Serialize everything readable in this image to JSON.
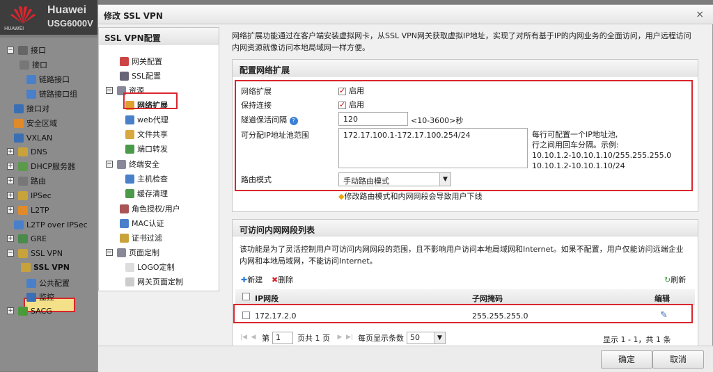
{
  "app": {
    "brand": "Huawei",
    "model": "USG6000V",
    "logo_text": "HUAWEI"
  },
  "nav": {
    "items": [
      {
        "label": "接口",
        "toggle": "−",
        "icon": "monitor-icon"
      },
      {
        "label": "接口",
        "icon": "interface-icon"
      },
      {
        "label": "链路接口",
        "icon": "link-icon"
      },
      {
        "label": "链路接口组",
        "icon": "link-group-icon"
      },
      {
        "label": "接口对",
        "icon": "interface-pair-icon"
      },
      {
        "label": "安全区域",
        "icon": "zone-icon"
      },
      {
        "label": "VXLAN",
        "icon": "vxlan-icon"
      },
      {
        "label": "DNS",
        "toggle": "+",
        "icon": "dns-icon"
      },
      {
        "label": "DHCP服务器",
        "toggle": "+",
        "icon": "dhcp-icon"
      },
      {
        "label": "路由",
        "toggle": "+",
        "icon": "route-icon"
      },
      {
        "label": "IPSec",
        "toggle": "+",
        "icon": "ipsec-icon"
      },
      {
        "label": "L2TP",
        "toggle": "+",
        "icon": "l2tp-icon"
      },
      {
        "label": "L2TP over IPSec",
        "icon": "l2tp-ipsec-icon"
      },
      {
        "label": "GRE",
        "toggle": "+",
        "icon": "gre-icon"
      },
      {
        "label": "SSL VPN",
        "toggle": "−",
        "icon": "sslvpn-icon"
      },
      {
        "label": "SSL VPN",
        "icon": "sslvpn-sub-icon"
      },
      {
        "label": "公共配置",
        "icon": "common-config-icon"
      },
      {
        "label": "监控",
        "icon": "monitor-sub-icon"
      },
      {
        "label": "SACG",
        "toggle": "+",
        "icon": "sacg-icon"
      }
    ]
  },
  "dialog": {
    "title": "修改 SSL VPN",
    "close": "×",
    "left": {
      "header": "SSL VPN配置",
      "items": [
        {
          "label": "网关配置",
          "icon": "gateway-icon"
        },
        {
          "label": "SSL配置",
          "icon": "ssl-icon"
        },
        {
          "label": "资源",
          "toggle": "−",
          "icon": "resource-icon"
        },
        {
          "label": "网络扩展",
          "icon": "network-extension-icon"
        },
        {
          "label": "web代理",
          "icon": "web-proxy-icon"
        },
        {
          "label": "文件共享",
          "icon": "file-share-icon"
        },
        {
          "label": "端口转发",
          "icon": "port-forward-icon"
        },
        {
          "label": "终端安全",
          "toggle": "−",
          "icon": "terminal-security-icon"
        },
        {
          "label": "主机检查",
          "icon": "host-check-icon"
        },
        {
          "label": "缓存清理",
          "icon": "cache-clean-icon"
        },
        {
          "label": "角色授权/用户",
          "icon": "role-icon"
        },
        {
          "label": "MAC认证",
          "icon": "mac-icon"
        },
        {
          "label": "证书过滤",
          "icon": "cert-icon"
        },
        {
          "label": "页面定制",
          "toggle": "−",
          "icon": "page-custom-icon"
        },
        {
          "label": "LOGO定制",
          "icon": "logo-custom-icon"
        },
        {
          "label": "网关页面定制",
          "icon": "gateway-page-icon"
        }
      ]
    },
    "intro": "网络扩展功能通过在客户端安装虚拟网卡，从SSL VPN网关获取虚拟IP地址，实现了对所有基于IP的内网业务的全面访问，用户远程访问内网资源就像访问本地局域网一样方便。",
    "config": {
      "header": "配置网络扩展",
      "net_ext_label": "网络扩展",
      "net_ext_enable": "启用",
      "keepalive_label": "保持连接",
      "keepalive_enable": "启用",
      "interval_label": "隧道保活间隔",
      "interval_value": "120",
      "interval_hint": "<10-3600>秒",
      "pool_label": "可分配IP地址池范围",
      "pool_value": "172.17.100.1-172.17.100.254/24",
      "pool_hint1": "每行可配置一个IP地址池,",
      "pool_hint2": "行之间用回车分隔。示例:",
      "pool_hint3": "10.10.1.2-10.10.1.10/255.255.255.0",
      "pool_hint4": "10.10.1.2-10.10.1.10/24",
      "route_label": "路由模式",
      "route_value": "手动路由模式",
      "warning": "修改路由模式和内网网段会导致用户下线"
    },
    "segments": {
      "header": "可访问内网网段列表",
      "desc": "该功能是为了灵活控制用户可访问内网网段的范围，且不影响用户访问本地局域网和Internet。如果不配置，用户仅能访问远端企业内网和本地局域网，不能访问Internet。",
      "new_label": "新建",
      "delete_label": "删除",
      "refresh_label": "刷新",
      "columns": [
        "IP网段",
        "子网掩码",
        "编辑"
      ],
      "rows": [
        {
          "ip": "172.17.2.0",
          "mask": "255.255.255.0"
        }
      ],
      "pager": {
        "page_prefix": "第",
        "page": "1",
        "page_suffix": "页共 1 页",
        "per_page_label": "每页显示条数",
        "per_page": "50",
        "summary": "显示 1 - 1，共 1 条"
      }
    },
    "ok": "确定",
    "cancel": "取消"
  }
}
